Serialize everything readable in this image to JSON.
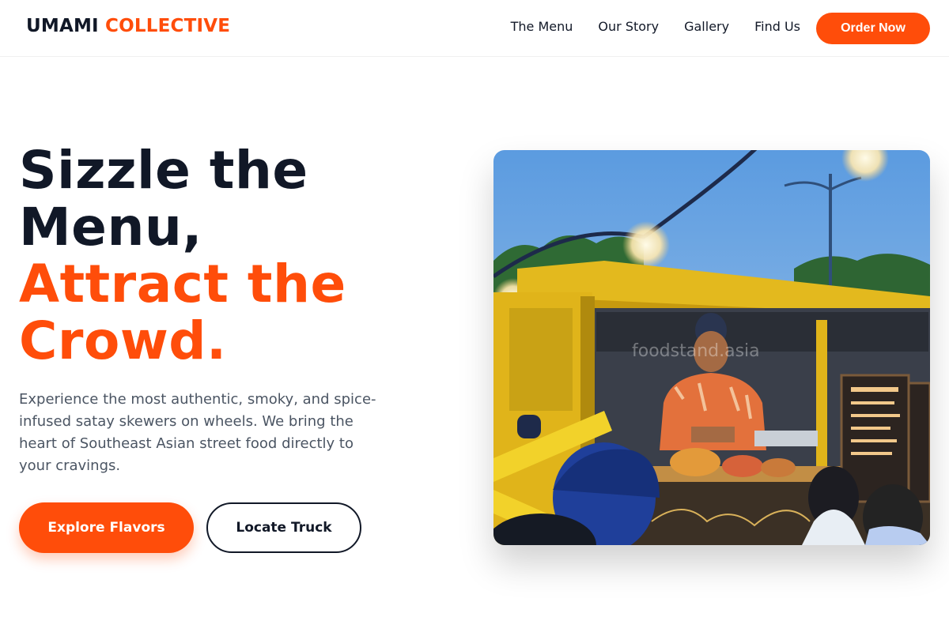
{
  "header": {
    "logo_part1": "UMAMI",
    "logo_part2": "COLLECTIVE",
    "nav": [
      {
        "label": "The Menu"
      },
      {
        "label": "Our Story"
      },
      {
        "label": "Gallery"
      },
      {
        "label": "Find Us"
      }
    ],
    "order_label": "Order Now"
  },
  "hero": {
    "title_line1": "Sizzle the",
    "title_line2": "Menu,",
    "title_line3": "Attract the",
    "title_line4": "Crowd.",
    "description": "Experience the most authentic, smoky, and spice-infused satay skewers on wheels. We bring the heart of Southeast Asian street food directly to your cravings.",
    "primary_button": "Explore Flavors",
    "secondary_button": "Locate Truck",
    "image_watermark": "foodstand.asia"
  },
  "colors": {
    "accent": "#ff4d0a",
    "text_dark": "#111827",
    "text_muted": "#4b5563"
  }
}
